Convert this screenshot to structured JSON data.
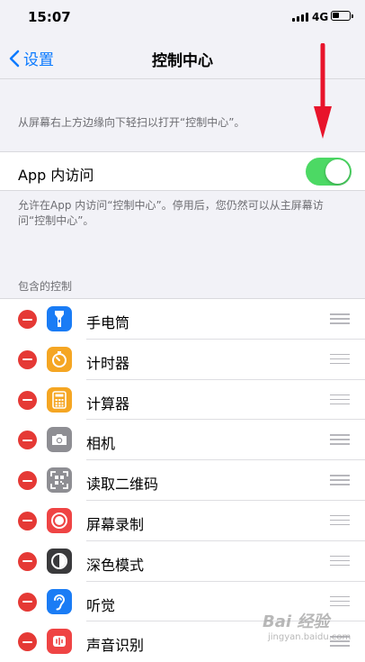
{
  "status_bar": {
    "time": "15:07",
    "network": "4G",
    "battery_level": 0.45
  },
  "nav": {
    "back_label": "设置",
    "title": "控制中心"
  },
  "intro_text": "从屏幕右上方边缘向下轻扫以打开“控制中心”。",
  "access_in_apps": {
    "label": "App 内访问",
    "enabled": true,
    "footer": "允许在App 内访问“控制中心”。停用后，您仍然可以从主屏幕访问“控制中心”。"
  },
  "included_controls": {
    "header": "包含的控制",
    "items": [
      {
        "label": "手电筒",
        "icon": "flashlight-icon",
        "color": "#1a7cf5"
      },
      {
        "label": "计时器",
        "icon": "timer-icon",
        "color": "#f5a623"
      },
      {
        "label": "计算器",
        "icon": "calculator-icon",
        "color": "#f5a623"
      },
      {
        "label": "相机",
        "icon": "camera-icon",
        "color": "#8e8e93"
      },
      {
        "label": "读取二维码",
        "icon": "qr-code-icon",
        "color": "#8e8e93"
      },
      {
        "label": "屏幕录制",
        "icon": "screen-recording-icon",
        "color": "#ef4444"
      },
      {
        "label": "深色模式",
        "icon": "dark-mode-icon",
        "color": "#3a3a3c"
      },
      {
        "label": "听觉",
        "icon": "hearing-icon",
        "color": "#1a7cf5"
      },
      {
        "label": "声音识别",
        "icon": "sound-recognition-icon",
        "color": "#ef4444"
      }
    ]
  },
  "colors": {
    "accent": "#0a7aff",
    "toggle_on": "#4cd964",
    "remove": "#e53935",
    "annotation_arrow": "#e8142b"
  },
  "watermark": {
    "brand": "Bai 经验",
    "sub": "jingyan.baidu.com"
  }
}
